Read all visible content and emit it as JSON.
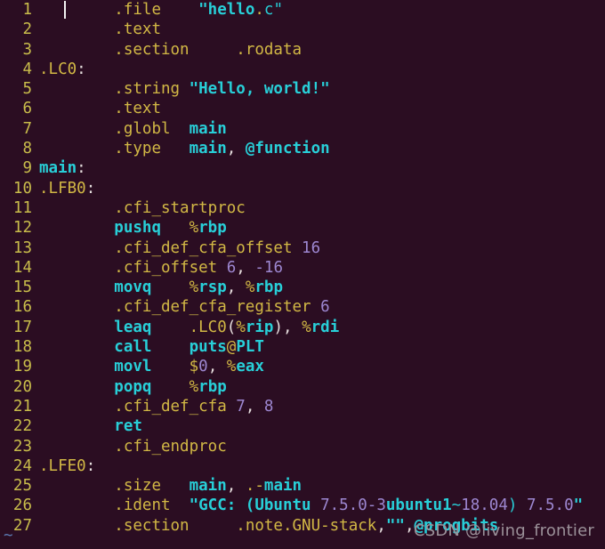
{
  "editor": {
    "type": "vim-assembly-listing",
    "background_color": "#2b0d22",
    "line_number_color": "#c9bd4b",
    "directive_color": "#d2b845",
    "keyword_color": "#28cfd8",
    "number_color": "#9d87d1",
    "punctuation_color": "#e6dede",
    "filler_marker": "~",
    "filler_marker_color": "#5b79b2",
    "cursor_visible": true,
    "cursor_line": 1
  },
  "watermark": {
    "text": "CSDN @living_frontier",
    "color": "#9b9199"
  },
  "lines": [
    {
      "num": "1",
      "text": "        .file    \"hello.c\""
    },
    {
      "num": "2",
      "text": "        .text"
    },
    {
      "num": "3",
      "text": "        .section     .rodata"
    },
    {
      "num": "4",
      "text": ".LC0:"
    },
    {
      "num": "5",
      "text": "        .string \"Hello, world!\""
    },
    {
      "num": "6",
      "text": "        .text"
    },
    {
      "num": "7",
      "text": "        .globl  main"
    },
    {
      "num": "8",
      "text": "        .type   main, @function"
    },
    {
      "num": "9",
      "text": "main:"
    },
    {
      "num": "10",
      "text": ".LFB0:"
    },
    {
      "num": "11",
      "text": "        .cfi_startproc"
    },
    {
      "num": "12",
      "text": "        pushq   %rbp"
    },
    {
      "num": "13",
      "text": "        .cfi_def_cfa_offset 16"
    },
    {
      "num": "14",
      "text": "        .cfi_offset 6, -16"
    },
    {
      "num": "15",
      "text": "        movq    %rsp, %rbp"
    },
    {
      "num": "16",
      "text": "        .cfi_def_cfa_register 6"
    },
    {
      "num": "17",
      "text": "        leaq    .LC0(%rip), %rdi"
    },
    {
      "num": "18",
      "text": "        call    puts@PLT"
    },
    {
      "num": "19",
      "text": "        movl    $0, %eax"
    },
    {
      "num": "20",
      "text": "        popq    %rbp"
    },
    {
      "num": "21",
      "text": "        .cfi_def_cfa 7, 8"
    },
    {
      "num": "22",
      "text": "        ret"
    },
    {
      "num": "23",
      "text": "        .cfi_endproc"
    },
    {
      "num": "24",
      "text": ".LFE0:"
    },
    {
      "num": "25",
      "text": "        .size   main, .-main"
    },
    {
      "num": "26",
      "text": "        .ident  \"GCC: (Ubuntu 7.5.0-3ubuntu1~18.04) 7.5.0\""
    },
    {
      "num": "27",
      "text": "        .section     .note.GNU-stack,\"\",@progbits"
    }
  ],
  "tokens": [
    [
      {
        "t": "        ",
        "c": "tok-punc"
      },
      {
        "t": ".file",
        "c": "tok-dir"
      },
      {
        "t": "    ",
        "c": "tok-punc"
      },
      {
        "t": "\"hello",
        "c": "tok-str"
      },
      {
        "t": ".",
        "c": "tok-sig"
      },
      {
        "t": "c\"",
        "c": "tok-strp"
      }
    ],
    [
      {
        "t": "        ",
        "c": "tok-punc"
      },
      {
        "t": ".text",
        "c": "tok-dir"
      }
    ],
    [
      {
        "t": "        ",
        "c": "tok-punc"
      },
      {
        "t": ".section",
        "c": "tok-dir"
      },
      {
        "t": "     ",
        "c": "tok-punc"
      },
      {
        "t": ".rodata",
        "c": "tok-dir"
      }
    ],
    [
      {
        "t": ".LC0",
        "c": "tok-lbl"
      },
      {
        "t": ":",
        "c": "tok-punc"
      }
    ],
    [
      {
        "t": "        ",
        "c": "tok-punc"
      },
      {
        "t": ".string",
        "c": "tok-dir"
      },
      {
        "t": " ",
        "c": "tok-punc"
      },
      {
        "t": "\"Hello, world!\"",
        "c": "tok-str"
      }
    ],
    [
      {
        "t": "        ",
        "c": "tok-punc"
      },
      {
        "t": ".text",
        "c": "tok-dir"
      }
    ],
    [
      {
        "t": "        ",
        "c": "tok-punc"
      },
      {
        "t": ".globl",
        "c": "tok-dir"
      },
      {
        "t": "  ",
        "c": "tok-punc"
      },
      {
        "t": "main",
        "c": "tok-key"
      }
    ],
    [
      {
        "t": "        ",
        "c": "tok-punc"
      },
      {
        "t": ".type",
        "c": "tok-dir"
      },
      {
        "t": "   ",
        "c": "tok-punc"
      },
      {
        "t": "main",
        "c": "tok-key"
      },
      {
        "t": ", ",
        "c": "tok-punc"
      },
      {
        "t": "@function",
        "c": "tok-key"
      }
    ],
    [
      {
        "t": "main",
        "c": "tok-key"
      },
      {
        "t": ":",
        "c": "tok-punc"
      }
    ],
    [
      {
        "t": ".LFB0",
        "c": "tok-lbl"
      },
      {
        "t": ":",
        "c": "tok-punc"
      }
    ],
    [
      {
        "t": "        ",
        "c": "tok-punc"
      },
      {
        "t": ".cfi_startproc",
        "c": "tok-dir"
      }
    ],
    [
      {
        "t": "        ",
        "c": "tok-punc"
      },
      {
        "t": "pushq",
        "c": "tok-key"
      },
      {
        "t": "   ",
        "c": "tok-punc"
      },
      {
        "t": "%",
        "c": "tok-sig"
      },
      {
        "t": "rbp",
        "c": "tok-key"
      }
    ],
    [
      {
        "t": "        ",
        "c": "tok-punc"
      },
      {
        "t": ".cfi_def_cfa_offset",
        "c": "tok-dir"
      },
      {
        "t": " ",
        "c": "tok-punc"
      },
      {
        "t": "16",
        "c": "tok-num"
      }
    ],
    [
      {
        "t": "        ",
        "c": "tok-punc"
      },
      {
        "t": ".cfi_offset",
        "c": "tok-dir"
      },
      {
        "t": " ",
        "c": "tok-punc"
      },
      {
        "t": "6",
        "c": "tok-num"
      },
      {
        "t": ", ",
        "c": "tok-punc"
      },
      {
        "t": "-16",
        "c": "tok-num"
      }
    ],
    [
      {
        "t": "        ",
        "c": "tok-punc"
      },
      {
        "t": "movq",
        "c": "tok-key"
      },
      {
        "t": "    ",
        "c": "tok-punc"
      },
      {
        "t": "%",
        "c": "tok-sig"
      },
      {
        "t": "rsp",
        "c": "tok-key"
      },
      {
        "t": ", ",
        "c": "tok-punc"
      },
      {
        "t": "%",
        "c": "tok-sig"
      },
      {
        "t": "rbp",
        "c": "tok-key"
      }
    ],
    [
      {
        "t": "        ",
        "c": "tok-punc"
      },
      {
        "t": ".cfi_def_cfa_register",
        "c": "tok-dir"
      },
      {
        "t": " ",
        "c": "tok-punc"
      },
      {
        "t": "6",
        "c": "tok-num"
      }
    ],
    [
      {
        "t": "        ",
        "c": "tok-punc"
      },
      {
        "t": "leaq",
        "c": "tok-key"
      },
      {
        "t": "    ",
        "c": "tok-punc"
      },
      {
        "t": ".LC0",
        "c": "tok-lbl"
      },
      {
        "t": "(",
        "c": "tok-punc"
      },
      {
        "t": "%",
        "c": "tok-sig"
      },
      {
        "t": "rip",
        "c": "tok-key"
      },
      {
        "t": "), ",
        "c": "tok-punc"
      },
      {
        "t": "%",
        "c": "tok-sig"
      },
      {
        "t": "rdi",
        "c": "tok-key"
      }
    ],
    [
      {
        "t": "        ",
        "c": "tok-punc"
      },
      {
        "t": "call",
        "c": "tok-key"
      },
      {
        "t": "    ",
        "c": "tok-punc"
      },
      {
        "t": "puts",
        "c": "tok-key"
      },
      {
        "t": "@",
        "c": "tok-sig"
      },
      {
        "t": "PLT",
        "c": "tok-key"
      }
    ],
    [
      {
        "t": "        ",
        "c": "tok-punc"
      },
      {
        "t": "movl",
        "c": "tok-key"
      },
      {
        "t": "    ",
        "c": "tok-punc"
      },
      {
        "t": "$",
        "c": "tok-sig"
      },
      {
        "t": "0",
        "c": "tok-num"
      },
      {
        "t": ", ",
        "c": "tok-punc"
      },
      {
        "t": "%",
        "c": "tok-sig"
      },
      {
        "t": "eax",
        "c": "tok-key"
      }
    ],
    [
      {
        "t": "        ",
        "c": "tok-punc"
      },
      {
        "t": "popq",
        "c": "tok-key"
      },
      {
        "t": "    ",
        "c": "tok-punc"
      },
      {
        "t": "%",
        "c": "tok-sig"
      },
      {
        "t": "rbp",
        "c": "tok-key"
      }
    ],
    [
      {
        "t": "        ",
        "c": "tok-punc"
      },
      {
        "t": ".cfi_def_cfa",
        "c": "tok-dir"
      },
      {
        "t": " ",
        "c": "tok-punc"
      },
      {
        "t": "7",
        "c": "tok-num"
      },
      {
        "t": ", ",
        "c": "tok-punc"
      },
      {
        "t": "8",
        "c": "tok-num"
      }
    ],
    [
      {
        "t": "        ",
        "c": "tok-punc"
      },
      {
        "t": "ret",
        "c": "tok-key"
      }
    ],
    [
      {
        "t": "        ",
        "c": "tok-punc"
      },
      {
        "t": ".cfi_endproc",
        "c": "tok-dir"
      }
    ],
    [
      {
        "t": ".LFE0",
        "c": "tok-lbl"
      },
      {
        "t": ":",
        "c": "tok-punc"
      }
    ],
    [
      {
        "t": "        ",
        "c": "tok-punc"
      },
      {
        "t": ".size",
        "c": "tok-dir"
      },
      {
        "t": "   ",
        "c": "tok-punc"
      },
      {
        "t": "main",
        "c": "tok-key"
      },
      {
        "t": ", ",
        "c": "tok-punc"
      },
      {
        "t": ".",
        "c": "tok-sig"
      },
      {
        "t": "-",
        "c": "tok-dir"
      },
      {
        "t": "main",
        "c": "tok-key"
      }
    ],
    [
      {
        "t": "        ",
        "c": "tok-punc"
      },
      {
        "t": ".ident",
        "c": "tok-dir"
      },
      {
        "t": "  ",
        "c": "tok-punc"
      },
      {
        "t": "\"GCC: (Ubuntu",
        "c": "tok-str"
      },
      {
        "t": " ",
        "c": "tok-punc"
      },
      {
        "t": "7.5.0-3",
        "c": "tok-num"
      },
      {
        "t": "ubuntu1",
        "c": "tok-str"
      },
      {
        "t": "~",
        "c": "tok-strp"
      },
      {
        "t": "18.04",
        "c": "tok-num"
      },
      {
        "t": ") ",
        "c": "tok-strp"
      },
      {
        "t": "7.5.0",
        "c": "tok-num"
      },
      {
        "t": "\"",
        "c": "tok-str"
      }
    ],
    [
      {
        "t": "        ",
        "c": "tok-punc"
      },
      {
        "t": ".section",
        "c": "tok-dir"
      },
      {
        "t": "     ",
        "c": "tok-punc"
      },
      {
        "t": ".note.GNU-stack",
        "c": "tok-dir"
      },
      {
        "t": ",",
        "c": "tok-punc"
      },
      {
        "t": "\"\"",
        "c": "tok-str"
      },
      {
        "t": ",",
        "c": "tok-punc"
      },
      {
        "t": "@progbits",
        "c": "tok-key"
      }
    ]
  ]
}
